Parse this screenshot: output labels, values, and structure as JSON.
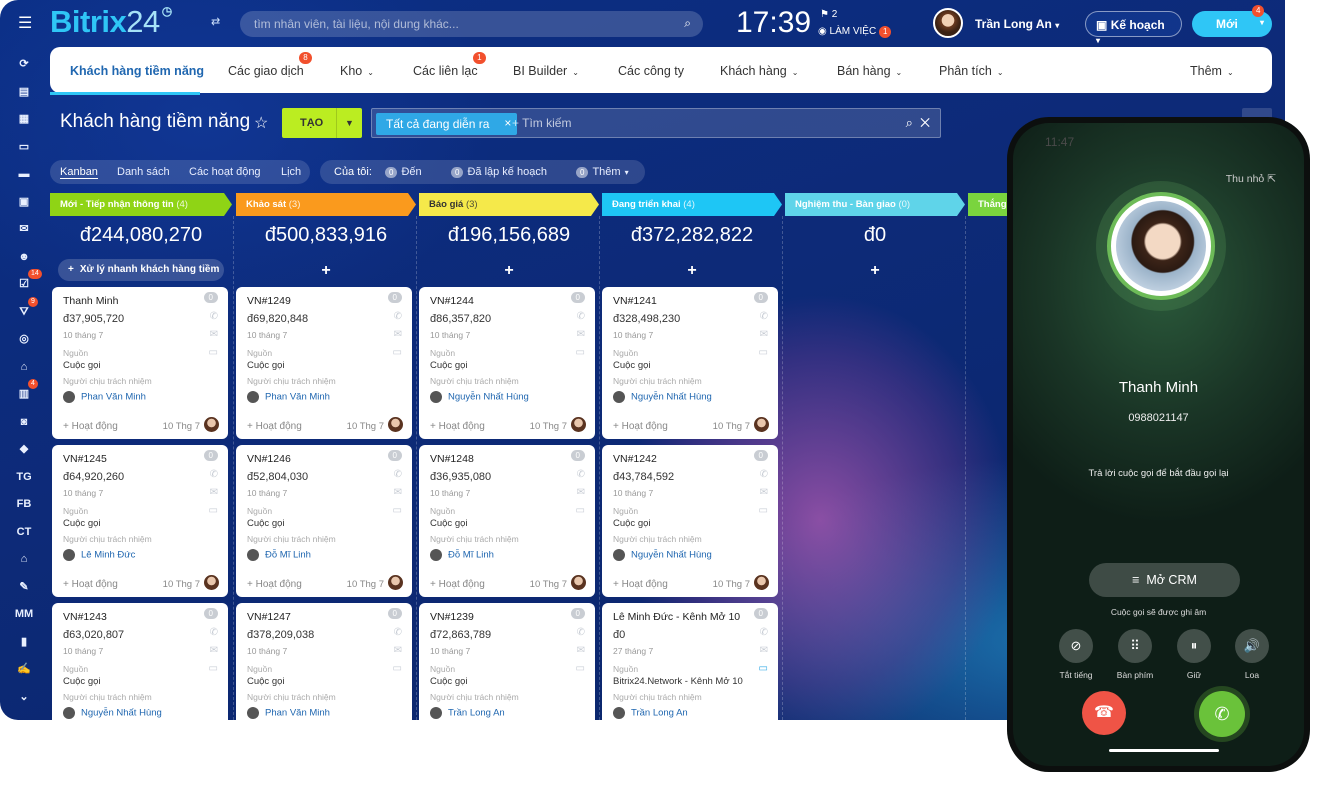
{
  "app": {
    "logo_main": "Bitrix",
    "logo_num": "24"
  },
  "topbar": {
    "search_placeholder": "tìm nhân viên, tài liệu, nội dung khác...",
    "clock": "17:39",
    "flag_count": "2",
    "work_label": "LÀM VIỆC",
    "work_badge": "1",
    "user_name": "Trần Long An",
    "plan_label": "Kế hoạch",
    "new_label": "Mới",
    "new_badge": "4"
  },
  "sidebar": {
    "items": [
      {
        "icon": "pulse-icon"
      },
      {
        "icon": "feed-icon"
      },
      {
        "icon": "calendar-icon"
      },
      {
        "icon": "docs-icon"
      },
      {
        "icon": "drive-icon"
      },
      {
        "icon": "chat-icon"
      },
      {
        "icon": "mail-icon"
      },
      {
        "icon": "group-icon"
      },
      {
        "icon": "tasks-icon",
        "badge": "14"
      },
      {
        "icon": "crm-icon",
        "badge": "9"
      },
      {
        "icon": "target-icon"
      },
      {
        "icon": "shop-icon"
      },
      {
        "icon": "cashbox-icon",
        "badge": "4"
      },
      {
        "icon": "robot-icon"
      },
      {
        "icon": "box-icon"
      },
      {
        "label": "TG"
      },
      {
        "label": "FB"
      },
      {
        "label": "CT"
      },
      {
        "icon": "bank-icon"
      },
      {
        "icon": "sign-icon"
      },
      {
        "label": "MM"
      },
      {
        "icon": "analytics-icon"
      },
      {
        "icon": "edit-icon"
      },
      {
        "icon": "more-icon"
      }
    ]
  },
  "nav": {
    "tabs": [
      {
        "label": "Khách hàng tiềm năng",
        "active": true
      },
      {
        "label": "Các giao dịch",
        "badge": "8"
      },
      {
        "label": "Kho",
        "dropdown": true
      },
      {
        "label": "Các liên lạc",
        "badge": "1"
      },
      {
        "label": "BI Builder",
        "dropdown": true
      },
      {
        "label": "Các công ty"
      },
      {
        "label": "Khách hàng",
        "dropdown": true
      },
      {
        "label": "Bán hàng",
        "dropdown": true
      },
      {
        "label": "Phân tích",
        "dropdown": true
      },
      {
        "label": "Thêm",
        "dropdown": true
      }
    ]
  },
  "page": {
    "title": "Khách hàng tiềm năng",
    "create_label": "TẠO",
    "filter_chip": "Tất cả đang diễn ra",
    "search_placeholder": "+ Tìm kiếm"
  },
  "views": {
    "items": [
      "Kanban",
      "Danh sách",
      "Các hoạt động",
      "Lịch"
    ],
    "active": "Kanban"
  },
  "my": {
    "label": "Của tôi:",
    "items": [
      {
        "count": "0",
        "label": "Đến"
      },
      {
        "count": "0",
        "label": "Đã lập kế hoạch"
      },
      {
        "count": "0",
        "label": "Thêm"
      }
    ]
  },
  "colors": {
    "accent": "#2fc6f6",
    "create": "#bbed21",
    "stage1": "#8fd415",
    "stage2": "#fa9a1d",
    "stage3": "#f5e94a",
    "stage4": "#1ec6f5",
    "stage5": "#5fd4e9",
    "stage6": "#7ad43e"
  },
  "columns": [
    {
      "name": "Mới - Tiếp nhận thông tin",
      "count": "(4)",
      "total": "đ244,080,270",
      "quick": "Xử lý nhanh khách hàng tiềm"
    },
    {
      "name": "Khảo sát",
      "count": "(3)",
      "total": "đ500,833,916"
    },
    {
      "name": "Báo giá",
      "count": "(3)",
      "total": "đ196,156,689"
    },
    {
      "name": "Đang triển khai",
      "count": "(4)",
      "total": "đ372,282,822"
    },
    {
      "name": "Nghiệm thu - Bàn giao",
      "count": "(0)",
      "total": "đ0"
    },
    {
      "name": "Thắng",
      "count": "",
      "total": ""
    }
  ],
  "card_labels": {
    "source": "Nguồn",
    "responsible": "Người chịu trách nhiệm",
    "activity": "+ Hoạt động",
    "zero": "0"
  },
  "cards": [
    [
      {
        "title": "Thanh Minh",
        "amount": "đ37,905,720",
        "date": "10 tháng 7",
        "source": "Cuộc gọi",
        "person": "Phan Văn Minh",
        "due": "10 Thg 7"
      },
      {
        "title": "VN#1245",
        "amount": "đ64,920,260",
        "date": "10 tháng 7",
        "source": "Cuộc gọi",
        "person": "Lê Minh Đức",
        "due": "10 Thg 7"
      },
      {
        "title": "VN#1243",
        "amount": "đ63,020,807",
        "date": "10 tháng 7",
        "source": "Cuộc gọi",
        "person": "Nguyễn Nhất Hùng",
        "due": ""
      }
    ],
    [
      {
        "title": "VN#1249",
        "amount": "đ69,820,848",
        "date": "10 tháng 7",
        "source": "Cuộc gọi",
        "person": "Phan Văn Minh",
        "due": "10 Thg 7"
      },
      {
        "title": "VN#1246",
        "amount": "đ52,804,030",
        "date": "10 tháng 7",
        "source": "Cuộc gọi",
        "person": "Đỗ Mĩ Linh",
        "due": "10 Thg 7"
      },
      {
        "title": "VN#1247",
        "amount": "đ378,209,038",
        "date": "10 tháng 7",
        "source": "Cuộc gọi",
        "person": "Phan Văn Minh",
        "due": ""
      }
    ],
    [
      {
        "title": "VN#1244",
        "amount": "đ86,357,820",
        "date": "10 tháng 7",
        "source": "Cuộc gọi",
        "person": "Nguyễn Nhất Hùng",
        "due": "10 Thg 7"
      },
      {
        "title": "VN#1248",
        "amount": "đ36,935,080",
        "date": "10 tháng 7",
        "source": "Cuộc gọi",
        "person": "Đỗ Mĩ Linh",
        "due": "10 Thg 7"
      },
      {
        "title": "VN#1239",
        "amount": "đ72,863,789",
        "date": "10 tháng 7",
        "source": "Cuộc gọi",
        "person": "Trần Long An",
        "due": ""
      }
    ],
    [
      {
        "title": "VN#1241",
        "amount": "đ328,498,230",
        "date": "10 tháng 7",
        "source": "Cuộc gọi",
        "person": "Nguyễn Nhất Hùng",
        "due": "10 Thg 7"
      },
      {
        "title": "VN#1242",
        "amount": "đ43,784,592",
        "date": "10 tháng 7",
        "source": "Cuộc gọi",
        "person": "Nguyễn Nhất Hùng",
        "due": "10 Thg 7"
      },
      {
        "title": "Lê Minh Đức - Kênh Mở 10",
        "amount": "đ0",
        "date": "27 tháng 7",
        "source": "Bitrix24.Network - Kênh Mở 10",
        "person": "Trần Long An",
        "due": ""
      }
    ]
  ],
  "phone": {
    "time": "11:47",
    "minimize": "Thu nhỏ",
    "caller_name": "Thanh Minh",
    "caller_phone": "0988021147",
    "message": "Trả lời cuộc gọi để bắt đầu gọi lại",
    "crm_button": "Mở CRM",
    "recorded": "Cuộc gọi sẽ được ghi âm",
    "controls": [
      {
        "label": "Tắt tiếng",
        "icon": "mic-off-icon"
      },
      {
        "label": "Bàn phím",
        "icon": "keypad-icon"
      },
      {
        "label": "Giữ",
        "icon": "pause-icon"
      },
      {
        "label": "Loa",
        "icon": "speaker-icon"
      }
    ]
  }
}
